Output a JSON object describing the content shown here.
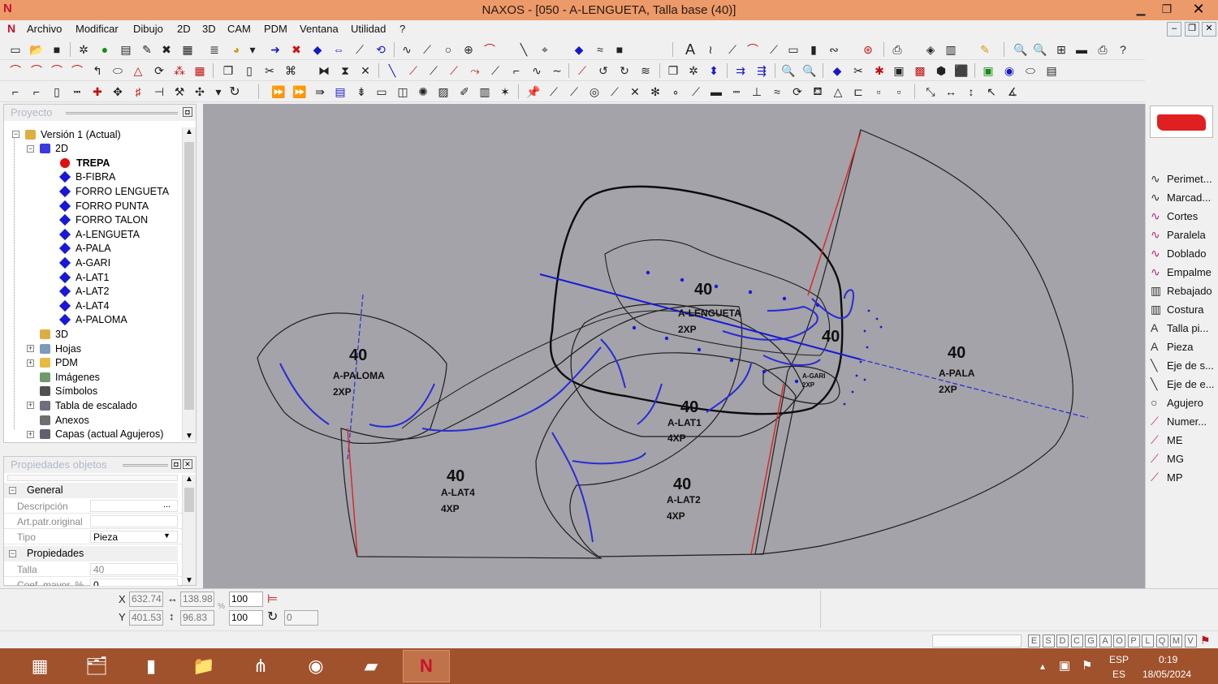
{
  "window": {
    "title": "NAXOS - [050 - A-LENGUETA, Talla base (40)]",
    "logo": "N"
  },
  "menu": [
    "Archivo",
    "Modificar",
    "Dibujo",
    "2D",
    "3D",
    "CAM",
    "PDM",
    "Ventana",
    "Utilidad",
    "?"
  ],
  "project_panel": {
    "title": "Proyecto",
    "tree": [
      {
        "label": "Versión 1 (Actual)",
        "level": 0,
        "icon": "version-icon",
        "expander": "−"
      },
      {
        "label": "2D",
        "level": 1,
        "icon": "2d-icon",
        "expander": "−"
      },
      {
        "label": "TREPA",
        "level": 2,
        "icon": "red-dot-icon",
        "bold": true
      },
      {
        "label": "B-FIBRA",
        "level": 2,
        "icon": "piece-icon"
      },
      {
        "label": "FORRO LENGUETA",
        "level": 2,
        "icon": "piece-icon"
      },
      {
        "label": "FORRO PUNTA",
        "level": 2,
        "icon": "piece-icon"
      },
      {
        "label": "FORRO TALON",
        "level": 2,
        "icon": "piece-icon"
      },
      {
        "label": "A-LENGUETA",
        "level": 2,
        "icon": "piece-icon"
      },
      {
        "label": "A-PALA",
        "level": 2,
        "icon": "piece-icon"
      },
      {
        "label": "A-GARI",
        "level": 2,
        "icon": "piece-icon"
      },
      {
        "label": "A-LAT1",
        "level": 2,
        "icon": "piece-icon"
      },
      {
        "label": "A-LAT2",
        "level": 2,
        "icon": "piece-icon"
      },
      {
        "label": "A-LAT4",
        "level": 2,
        "icon": "piece-icon"
      },
      {
        "label": "A-PALOMA",
        "level": 2,
        "icon": "piece-icon"
      },
      {
        "label": "3D",
        "level": 1,
        "icon": "3d-icon"
      },
      {
        "label": "Hojas",
        "level": 1,
        "icon": "sheets-icon",
        "expander": "+"
      },
      {
        "label": "PDM",
        "level": 1,
        "icon": "folder-icon",
        "expander": "+"
      },
      {
        "label": "Imágenes",
        "level": 1,
        "icon": "images-icon"
      },
      {
        "label": "Símbolos",
        "level": 1,
        "icon": "symbols-icon"
      },
      {
        "label": "Tabla de escalado",
        "level": 1,
        "icon": "table-icon",
        "expander": "+"
      },
      {
        "label": "Anexos",
        "level": 1,
        "icon": "clip-icon"
      },
      {
        "label": "Capas (actual Agujeros)",
        "level": 1,
        "icon": "layers-icon",
        "expander": "+"
      }
    ]
  },
  "props_panel": {
    "title": "Propiedades objetos",
    "groups": [
      {
        "label": "General",
        "rows": [
          {
            "key": "Descripción",
            "value": "",
            "button": "..."
          },
          {
            "key": "Art.patr.original",
            "value": ""
          },
          {
            "key": "Tipo",
            "value": "Pieza",
            "dropdown": true
          }
        ]
      },
      {
        "label": "Propiedades",
        "rows": [
          {
            "key": "Talla",
            "value": "40"
          },
          {
            "key": "Coef. mayor. %",
            "value": "0"
          }
        ]
      }
    ]
  },
  "canvas": {
    "pieces": [
      {
        "size": "40",
        "name": "A-PALOMA",
        "qty": "2XP"
      },
      {
        "size": "40",
        "name": "A-LENGUETA",
        "qty": "2XP"
      },
      {
        "size": "40",
        "name": "",
        "qty": ""
      },
      {
        "size": "40",
        "name": "A-PALA",
        "qty": "2XP"
      },
      {
        "size": "40",
        "name": "A-LAT1",
        "qty": "4XP"
      },
      {
        "size": "40",
        "name": "A-LAT4",
        "qty": "4XP"
      },
      {
        "size": "40",
        "name": "A-LAT2",
        "qty": "4XP"
      },
      {
        "size": "",
        "name": "A-GARI",
        "qty": "2XP"
      }
    ]
  },
  "right_tools": [
    "Perimet...",
    "Marcad...",
    "Cortes",
    "Paralela",
    "Doblado",
    "Empalme",
    "Rebajado",
    "Costura",
    "Talla pi...",
    "Pieza",
    "Eje de s...",
    "Eje de e...",
    "Agujero",
    "Numer...",
    "ME",
    "MG",
    "MP"
  ],
  "coords": {
    "x_label": "X",
    "y_label": "Y",
    "x": "632.74",
    "y": "401.53",
    "width": "138.98",
    "height": "96.83",
    "scale_x": "100",
    "scale_y": "100",
    "rotation": "0",
    "percent": "%"
  },
  "status_keys": [
    "E",
    "S",
    "D",
    "C",
    "G",
    "A",
    "O",
    "P",
    "L",
    "Q",
    "M",
    "V"
  ],
  "tray": {
    "lang_top": "ESP",
    "lang_bottom": "ES",
    "time": "0:19",
    "date": "18/05/2024"
  },
  "colors": {
    "titlebar": "#ec9a6a",
    "canvas": "#a3a3a9",
    "taskbar": "#a0522d",
    "outline": "#1a1a1a",
    "stitch": "#2a2ad8",
    "red_line": "#e02020"
  }
}
